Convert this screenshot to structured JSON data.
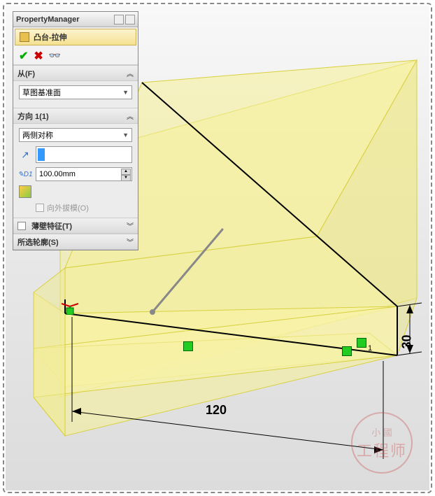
{
  "panel": {
    "title": "PropertyManager",
    "feature_title": "凸台-拉伸",
    "sections": {
      "from": {
        "label": "从(F)",
        "select_value": "草图基准面"
      },
      "dir1": {
        "label": "方向 1(1)",
        "end_condition": "两侧对称",
        "depth": "100.00mm",
        "draft_label": "向外拔模(O)"
      },
      "thin": {
        "label": "薄壁特征(T)"
      },
      "contour": {
        "label": "所选轮廓(S)"
      }
    }
  },
  "dims": {
    "width": "120",
    "height": "30"
  },
  "constraint_sub": "1",
  "watermark": {
    "small": "小 國",
    "big": "工程师"
  }
}
